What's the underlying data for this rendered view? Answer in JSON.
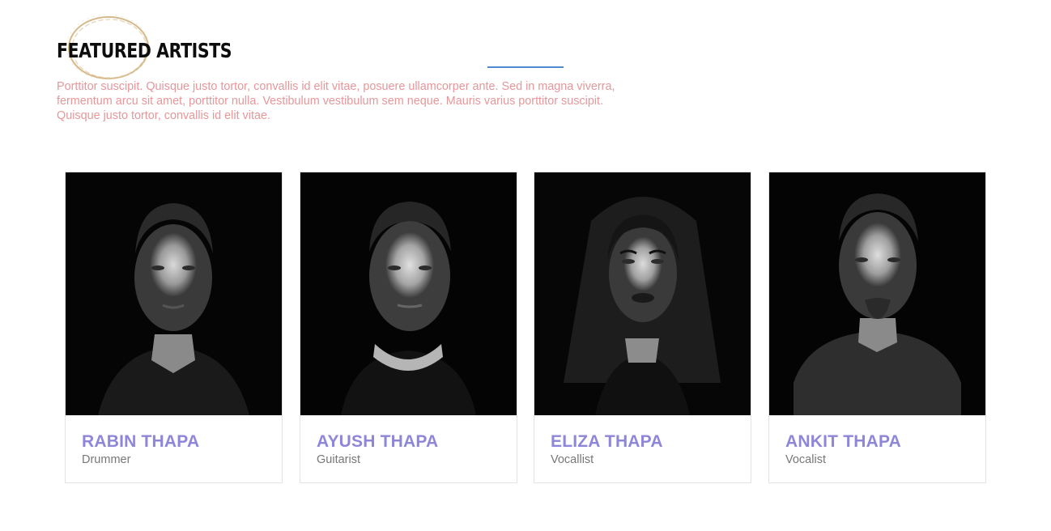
{
  "section": {
    "title": "FEATURED ARTISTS",
    "intro": "Porttitor suscipit. Quisque justo tortor, convallis id elit vitae, posuere ullamcorper ante. Sed in magna viverra, fermentum arcu sit amet, porttitor nulla. Vestibulum vestibulum sem neque. Mauris varius porttitor suscipit. Quisque justo tortor, convallis id elit vitae.",
    "accent_color": "#4f8ad1",
    "intro_color": "#e6979a",
    "name_color": "#8e86d9"
  },
  "artists": [
    {
      "name": "RABIN THAPA",
      "role": "Drummer"
    },
    {
      "name": "AYUSH THAPA",
      "role": "Guitarist"
    },
    {
      "name": "ELIZA THAPA",
      "role": "Vocallist"
    },
    {
      "name": "ANKIT THAPA",
      "role": "Vocalist"
    }
  ]
}
